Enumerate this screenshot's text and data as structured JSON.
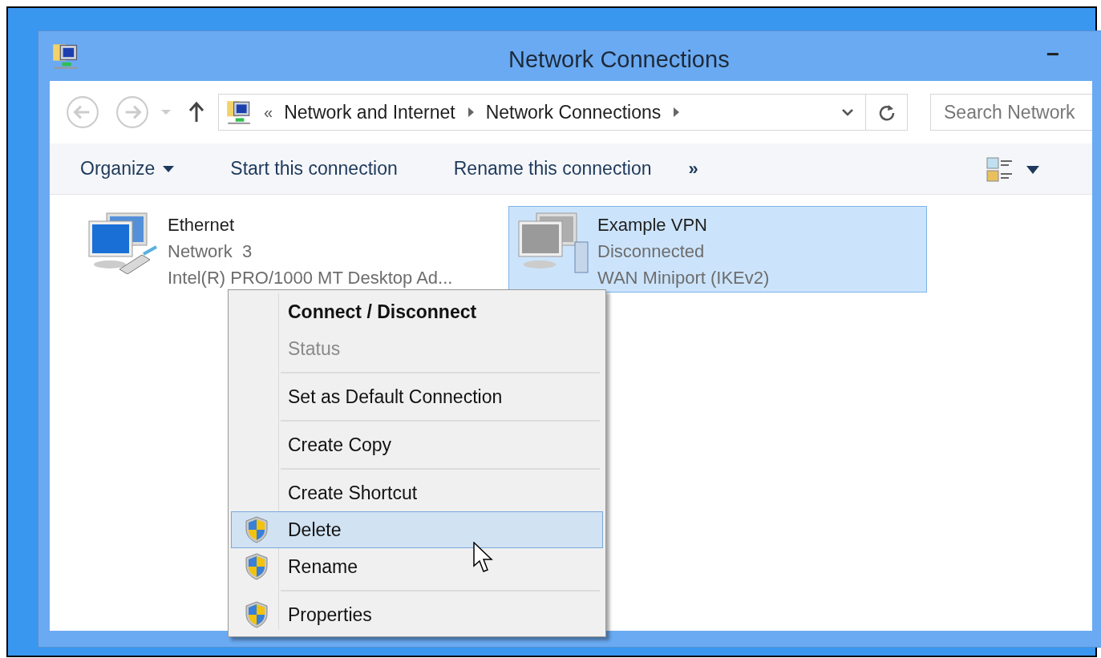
{
  "window": {
    "title": "Network Connections",
    "minimize": "−"
  },
  "address": {
    "prefix": "«",
    "path": [
      "Network and Internet",
      "Network Connections"
    ]
  },
  "search": {
    "placeholder": "Search Network"
  },
  "toolbar": {
    "items": [
      {
        "label": "Organize",
        "dropdown": true
      },
      {
        "label": "Start this connection",
        "dropdown": false
      },
      {
        "label": "Rename this connection",
        "dropdown": false
      }
    ],
    "more": "»"
  },
  "connections": [
    {
      "kind": "ethernet",
      "name": "Ethernet",
      "status": "Network  3",
      "device": "Intel(R) PRO/1000 MT Desktop Ad...",
      "selected": false
    },
    {
      "kind": "vpn",
      "name": "Example VPN",
      "status": "Disconnected",
      "device": "WAN Miniport (IKEv2)",
      "selected": true
    }
  ],
  "context_menu": [
    {
      "kind": "item",
      "label": "Connect / Disconnect",
      "default": true,
      "disabled": false,
      "shield": false,
      "selected": false
    },
    {
      "kind": "item",
      "label": "Status",
      "default": false,
      "disabled": true,
      "shield": false,
      "selected": false
    },
    {
      "kind": "separator"
    },
    {
      "kind": "item",
      "label": "Set as Default Connection",
      "default": false,
      "disabled": false,
      "shield": false,
      "selected": false
    },
    {
      "kind": "separator"
    },
    {
      "kind": "item",
      "label": "Create Copy",
      "default": false,
      "disabled": false,
      "shield": false,
      "selected": false
    },
    {
      "kind": "separator"
    },
    {
      "kind": "item",
      "label": "Create Shortcut",
      "default": false,
      "disabled": false,
      "shield": false,
      "selected": false
    },
    {
      "kind": "item",
      "label": "Delete",
      "default": false,
      "disabled": false,
      "shield": true,
      "selected": true
    },
    {
      "kind": "item",
      "label": "Rename",
      "default": false,
      "disabled": false,
      "shield": true,
      "selected": false
    },
    {
      "kind": "separator"
    },
    {
      "kind": "item",
      "label": "Properties",
      "default": false,
      "disabled": false,
      "shield": true,
      "selected": false
    }
  ]
}
